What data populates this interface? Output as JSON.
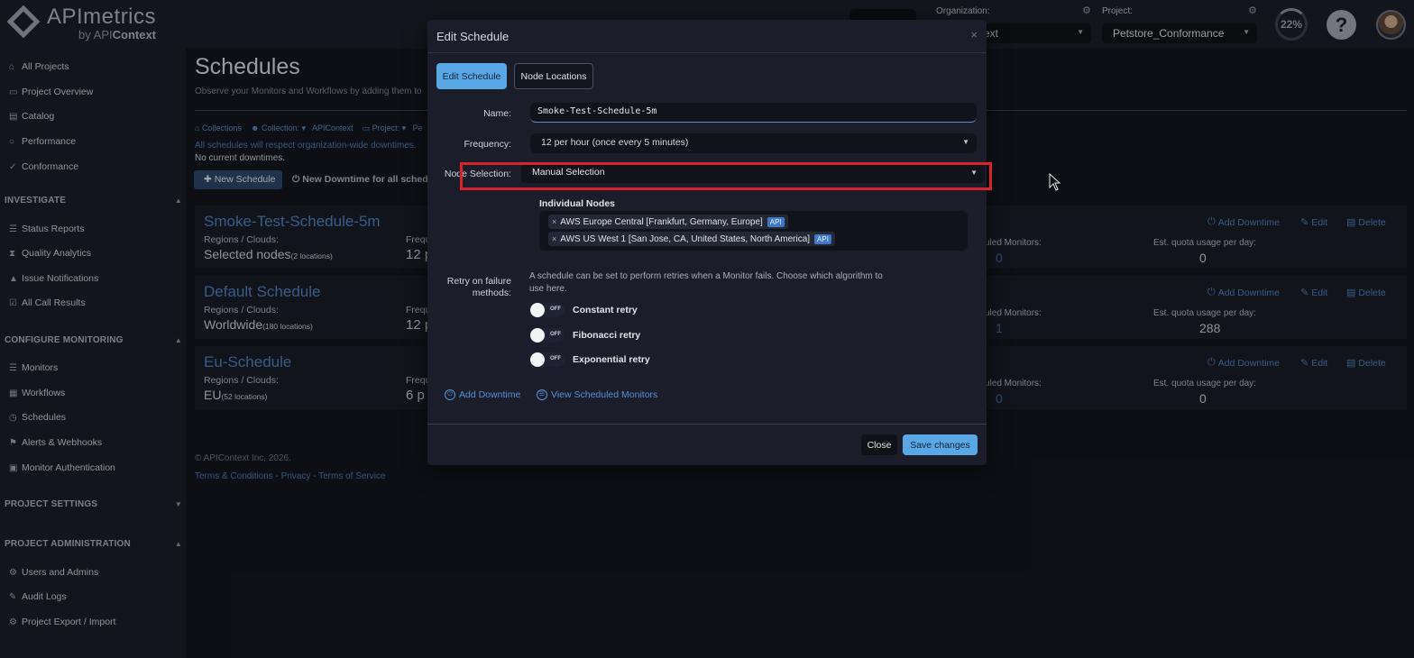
{
  "brand": {
    "title": "APImetrics",
    "sub_by": "by API",
    "sub_brand": "Context"
  },
  "header": {
    "organization_label": "Organization:",
    "organization_value": "ext",
    "project_label": "Project:",
    "project_value": "Petstore_Conformance",
    "quota_percent": "22%",
    "help_symbol": "?"
  },
  "sidebar": {
    "top_items": [
      {
        "label": "All Projects",
        "icon": "home-icon"
      },
      {
        "label": "Project Overview",
        "icon": "folder-icon"
      },
      {
        "label": "Catalog",
        "icon": "book-icon"
      },
      {
        "label": "Performance",
        "icon": "circle-icon"
      },
      {
        "label": "Conformance",
        "icon": "check-icon"
      }
    ],
    "sections": [
      {
        "title": "INVESTIGATE",
        "items": [
          "Status Reports",
          "Quality Analytics",
          "Issue Notifications",
          "All Call Results"
        ]
      },
      {
        "title": "CONFIGURE MONITORING",
        "items": [
          "Monitors",
          "Workflows",
          "Schedules",
          "Alerts & Webhooks",
          "Monitor Authentication"
        ]
      },
      {
        "title": "PROJECT SETTINGS",
        "items": []
      },
      {
        "title": "PROJECT ADMINISTRATION",
        "items": [
          "Users and Admins",
          "Audit Logs",
          "Project Export / Import"
        ]
      }
    ]
  },
  "page": {
    "title": "Schedules",
    "subtitle": "Observe your Monitors and Workflows by adding them to",
    "breadcrumb": {
      "collections": "Collections",
      "collection_label": "Collection:",
      "collection_value": "APIContext",
      "project_label": "Project:",
      "project_value": "Pe"
    },
    "info_downtimes": "All schedules will respect organization-wide downtimes.",
    "no_downtimes": "No current downtimes.",
    "new_schedule_label": "New Schedule",
    "new_downtime_label": "New Downtime for all schedul"
  },
  "cards": [
    {
      "title": "Smoke-Test-Schedule-5m",
      "regions_label": "Regions / Clouds:",
      "regions_value": "Selected nodes",
      "regions_count": "(2 locations)",
      "freq_label": "Frequ",
      "freq_value": "12 p",
      "monitors_label": "uled Monitors:",
      "monitors_value": "0",
      "quota_label": "Est. quota usage per day:",
      "quota_value": "0"
    },
    {
      "title": "Default Schedule",
      "regions_label": "Regions / Clouds:",
      "regions_value": "Worldwide",
      "regions_count": "(180 locations)",
      "freq_label": "Frequ",
      "freq_value": "12 p",
      "monitors_label": "uled Monitors:",
      "monitors_value": "1",
      "quota_label": "Est. quota usage per day:",
      "quota_value": "288"
    },
    {
      "title": "Eu-Schedule",
      "regions_label": "Regions / Clouds:",
      "regions_value": "EU",
      "regions_count": "(52 locations)",
      "freq_label": "Frequ",
      "freq_value": "6 p",
      "monitors_label": "uled Monitors:",
      "monitors_value": "0",
      "quota_label": "Est. quota usage per day:",
      "quota_value": "0"
    }
  ],
  "card_actions": {
    "add_downtime": "Add Downtime",
    "edit": "Edit",
    "delete": "Delete"
  },
  "footer": {
    "copyright": "© APIContext Inc, 2026.",
    "terms": "Terms & Conditions",
    "privacy": "Privacy",
    "tos": "Terms of Service",
    "sep": " - "
  },
  "modal": {
    "title": "Edit Schedule",
    "close_symbol": "×",
    "tabs": {
      "edit": "Edit Schedule",
      "nodes": "Node Locations"
    },
    "name_label": "Name:",
    "name_value": "Smoke-Test-Schedule-5m",
    "frequency_label": "Frequency:",
    "frequency_value": "12 per hour (once every 5 minutes)",
    "node_selection_label": "Node Selection:",
    "node_selection_value": "Manual Selection",
    "individual_nodes_title": "Individual Nodes",
    "nodes": [
      {
        "label": "AWS Europe Central [Frankfurt, Germany, Europe]",
        "badge": "API"
      },
      {
        "label": "AWS US West 1 [San Jose, CA, United States, North America]",
        "badge": "API"
      }
    ],
    "retry_label": "Retry on failure methods:",
    "retry_description": "A schedule can be set to perform retries when a Monitor fails. Choose which algorithm to use here.",
    "retry_options": [
      {
        "label": "Constant retry",
        "state": "OFF"
      },
      {
        "label": "Fibonacci retry",
        "state": "OFF"
      },
      {
        "label": "Exponential retry",
        "state": "OFF"
      }
    ],
    "add_downtime_link": "Add Downtime",
    "view_monitors_link": "View Scheduled Monitors",
    "close_button": "Close",
    "save_button": "Save changes"
  },
  "colors": {
    "accent": "#5aa7e6",
    "highlight": "#d8232a",
    "link": "#4d80bd"
  }
}
